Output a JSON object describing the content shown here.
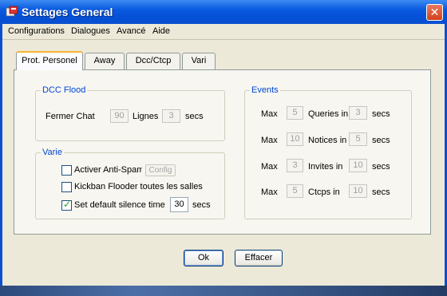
{
  "window": {
    "title": "Settages General",
    "close": "✕"
  },
  "menu": [
    "Configurations",
    "Dialogues",
    "Avancé",
    "Aide"
  ],
  "tabs": [
    "Prot. Personel",
    "Away",
    "Dcc/Ctcp",
    "Vari"
  ],
  "dcc": {
    "label": "DCC Flood",
    "prefix": "Fermer Chat",
    "value1": "90",
    "mid": "Lignes",
    "value2": "3",
    "suffix": "secs"
  },
  "varie": {
    "label": "Varie",
    "antispam": {
      "label": "Activer Anti-Spam",
      "checked": false,
      "config": "Config"
    },
    "kickban": {
      "label": "Kickban Flooder toutes les salles",
      "checked": false
    },
    "silence": {
      "label": "Set default silence time",
      "checked": true,
      "value": "30",
      "suffix": "secs"
    }
  },
  "events": {
    "label": "Events",
    "rows": [
      {
        "max_label": "Max",
        "count": "5",
        "type": "Queries in",
        "secs": "3",
        "unit": "secs"
      },
      {
        "max_label": "Max",
        "count": "10",
        "type": "Notices in",
        "secs": "5",
        "unit": "secs"
      },
      {
        "max_label": "Max",
        "count": "3",
        "type": "Invites in",
        "secs": "10",
        "unit": "secs"
      },
      {
        "max_label": "Max",
        "count": "5",
        "type": "Ctcps in",
        "secs": "10",
        "unit": "secs"
      }
    ]
  },
  "buttons": {
    "ok": "Ok",
    "clear": "Effacer"
  },
  "colors": {
    "titlebar": "#0a5ae0",
    "group_label": "#0046d5",
    "tab_highlight": "#f8b432"
  }
}
